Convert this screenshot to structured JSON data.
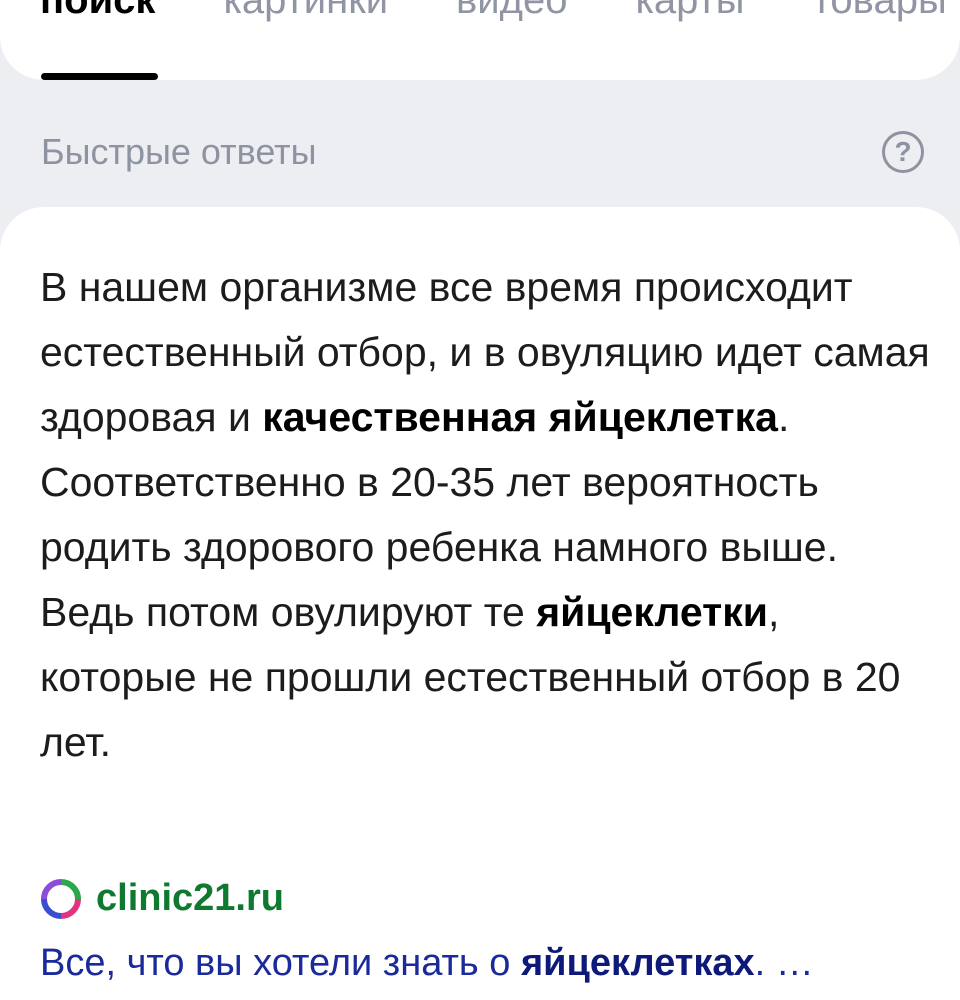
{
  "tabs": [
    {
      "label": "поиск",
      "active": true
    },
    {
      "label": "картинки",
      "active": false
    },
    {
      "label": "видео",
      "active": false
    },
    {
      "label": "карты",
      "active": false
    },
    {
      "label": "товары",
      "active": false
    }
  ],
  "section": {
    "title": "Быстрые ответы",
    "help_glyph": "?"
  },
  "answer": {
    "p1": "В нашем организме все время происходит естественный отбор, и в овуляцию идет самая здоровая и ",
    "p1_bold": "качественная яйцеклетка",
    "p2": ". Соответственно в 20-35 лет вероятность родить здорового ребенка намного выше. Ведь потом овулируют те ",
    "p2_bold": "яйцеклетки",
    "p3": ", которые не прошли естественный отбор в 20 лет."
  },
  "source": {
    "domain": "clinic21.ru",
    "icon": "clinic-favicon-icon",
    "link_text": "Все, что вы хотели знать о ",
    "link_bold": "яйцеклетках",
    "link_tail": ". …"
  },
  "colors": {
    "background": "#eceef2",
    "muted": "#8d93a0",
    "domain_green": "#0f7a2f",
    "link_blue": "#1a2a9b"
  }
}
